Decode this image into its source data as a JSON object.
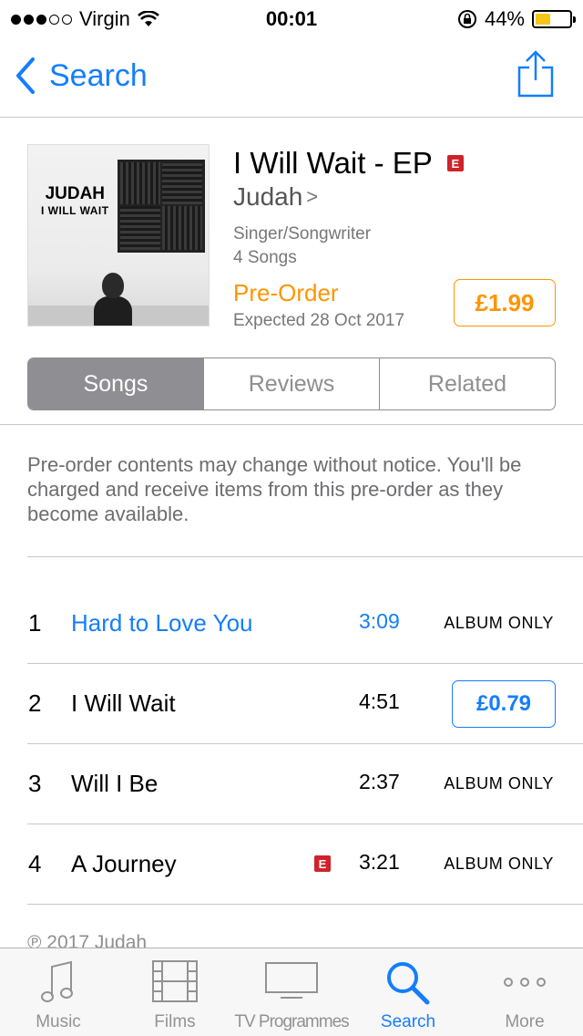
{
  "status": {
    "carrier": "Virgin",
    "time": "00:01",
    "battery": "44%",
    "battery_level": 0.44,
    "battery_color": "#f5c518"
  },
  "nav": {
    "back_label": "Search"
  },
  "album": {
    "art_title": "JUDAH",
    "art_subtitle": "I WILL WAIT",
    "title": "I Will Wait - EP",
    "explicit": "E",
    "artist": "Judah",
    "genre": "Singer/Songwriter",
    "song_count": "4 Songs",
    "pre_order": "Pre-Order",
    "expected": "Expected 28 Oct 2017",
    "price": "£1.99"
  },
  "segments": [
    "Songs",
    "Reviews",
    "Related"
  ],
  "notice": "Pre-order contents may change without notice. You'll be charged and receive items from this pre-order as they become available.",
  "tracks": [
    {
      "num": "1",
      "name": "Hard to Love You",
      "duration": "3:09",
      "action": "ALBUM ONLY"
    },
    {
      "num": "2",
      "name": "I Will Wait",
      "duration": "4:51",
      "action": "£0.79"
    },
    {
      "num": "3",
      "name": "Will I Be",
      "duration": "2:37",
      "action": "ALBUM ONLY"
    },
    {
      "num": "4",
      "name": "A Journey",
      "duration": "3:21",
      "action": "ALBUM ONLY",
      "explicit": "E"
    }
  ],
  "copyright": "℗ 2017 Judah",
  "tabs": [
    {
      "label": "Music",
      "icon": "music-note-icon"
    },
    {
      "label": "Films",
      "icon": "film-icon"
    },
    {
      "label": "TV Programmes",
      "icon": "tv-icon"
    },
    {
      "label": "Search",
      "icon": "search-icon"
    },
    {
      "label": "More",
      "icon": "more-icon"
    }
  ],
  "colors": {
    "accent": "#147efb",
    "pre_order": "#ff9500",
    "explicit": "#d0222b"
  }
}
